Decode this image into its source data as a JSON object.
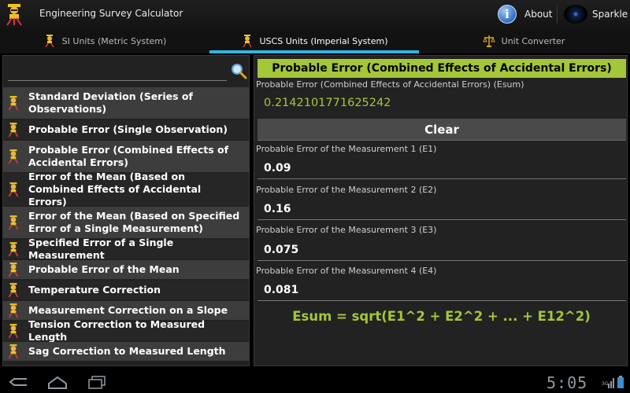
{
  "app": {
    "title": "Engineering Survey Calculator",
    "about_label": "About",
    "sparkle_label": "Sparkle"
  },
  "tabs": [
    {
      "label": "SI Units (Metric System)",
      "icon": "surveyor-icon",
      "active": false
    },
    {
      "label": "USCS Units (Imperial System)",
      "icon": "surveyor-icon",
      "active": true
    },
    {
      "label": "Unit Converter",
      "icon": "scale-icon",
      "active": false
    }
  ],
  "search": {
    "value": "",
    "placeholder": ""
  },
  "list": [
    "Standard Deviation (Series of Observations)",
    "Probable Error (Single Observation)",
    "Probable Error (Combined Effects of Accidental Errors)",
    "Error of the Mean (Based on Combined Effects of Accidental Errors)",
    "Error of the Mean (Based on Specified Error of a Single Measurement)",
    "Specified Error of a Single Measurement",
    "Probable Error of the Mean",
    "Temperature Correction",
    "Measurement Correction on a Slope",
    "Tension Correction to Measured Length",
    "Sag Correction to Measured Length"
  ],
  "calculator": {
    "title": "Probable Error (Combined Effects of Accidental Errors)",
    "result_label": "Probable Error (Combined Effects of Accidental Errors) (Esum)",
    "result_value": "0.2142101771625242",
    "clear_label": "Clear",
    "inputs": [
      {
        "label": "Probable Error of the Measurement 1 (E1)",
        "value": "0.09"
      },
      {
        "label": "Probable Error of the Measurement 2 (E2)",
        "value": "0.16"
      },
      {
        "label": "Probable Error of the Measurement 3 (E3)",
        "value": "0.075"
      },
      {
        "label": "Probable Error of the Measurement 4 (E4)",
        "value": "0.081"
      }
    ],
    "formula": "Esum = sqrt(E1^2 + E2^2 + ... + E12^2)"
  },
  "status": {
    "time": "5:05",
    "network": "3G"
  },
  "colors": {
    "accent_green": "#a4c639",
    "tab_indicator": "#33b5e5"
  }
}
